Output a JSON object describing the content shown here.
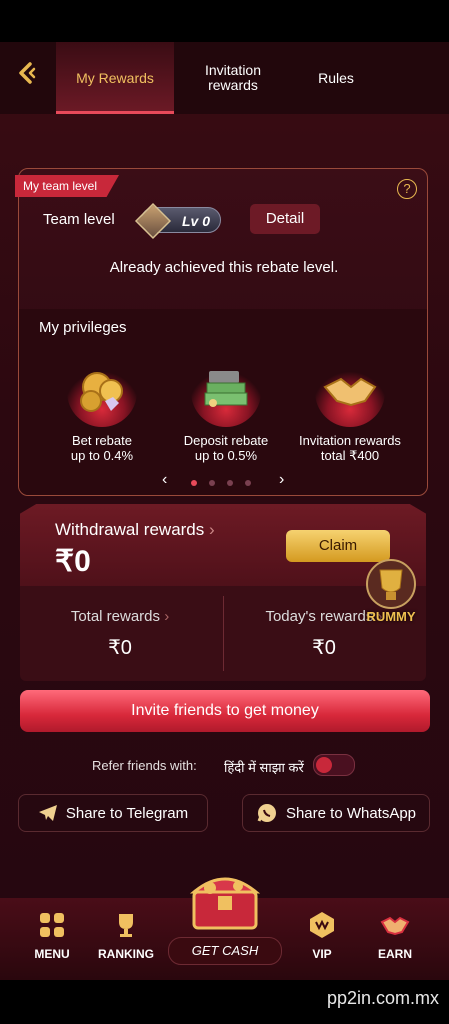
{
  "header": {
    "tabs": [
      {
        "label": "My Rewards",
        "active": true
      },
      {
        "label": "Invitation\nrewards",
        "active": false
      },
      {
        "label": "Rules",
        "active": false
      }
    ]
  },
  "team": {
    "ribbon": "My team level",
    "team_level_label": "Team level",
    "level_badge": "Lv 0",
    "detail_label": "Detail",
    "achieved_text": "Already achieved this rebate level."
  },
  "privileges": {
    "title": "My privileges",
    "items": [
      {
        "line1": "Bet rebate",
        "line2": "up to 0.4%"
      },
      {
        "line1": "Deposit rebate",
        "line2": "up to 0.5%"
      },
      {
        "line1": "Invitation rewards",
        "line2": "total ₹400"
      }
    ],
    "page_count": 4,
    "active_page": 0
  },
  "withdrawal": {
    "label": "Withdrawal rewards",
    "value": "₹0",
    "claim_label": "Claim"
  },
  "totals": {
    "total_label": "Total rewards",
    "total_value": "₹0",
    "today_label": "Today's rewards",
    "today_value": "₹0"
  },
  "rummy_label": "RUMMY",
  "invite_label": "Invite friends to get money",
  "refer": {
    "label": "Refer friends with:",
    "hindi": "हिंदी में साझा करें",
    "enabled": false
  },
  "share": {
    "telegram": "Share to Telegram",
    "whatsapp": "Share to WhatsApp"
  },
  "nav": {
    "menu": "MENU",
    "ranking": "RANKING",
    "getcash": "GET CASH",
    "vip": "VIP",
    "earn": "EARN"
  },
  "watermark": "pp2in.com.mx",
  "colors": {
    "accent": "#e84a5a",
    "gold": "#e8b850",
    "bg": "#2c0810"
  }
}
